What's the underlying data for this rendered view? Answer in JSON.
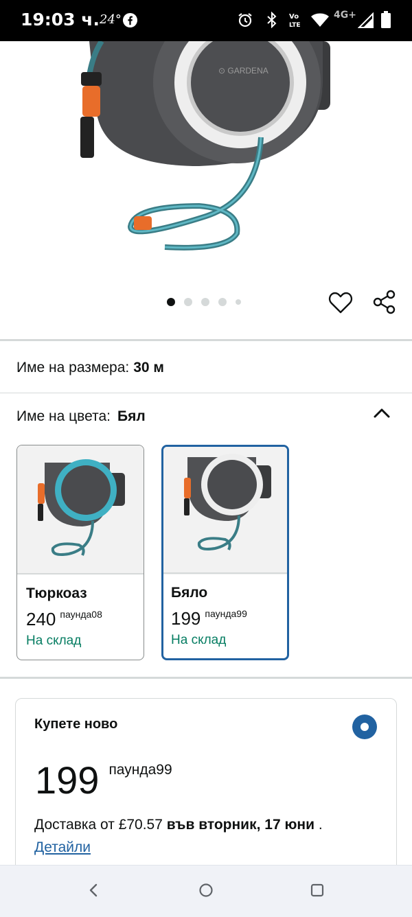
{
  "status_bar": {
    "time": "19:03 ч.",
    "temperature": "24°",
    "network": "4G+",
    "icons": [
      "facebook-icon",
      "alarm-icon",
      "bluetooth-icon",
      "volte-icon",
      "wifi-icon",
      "signal-icon",
      "battery-icon"
    ]
  },
  "product_image": {
    "brand_logo": "GARDENA",
    "carousel_count": 5,
    "carousel_active_index": 0
  },
  "size": {
    "label": "Име на размера:",
    "value": "30 м"
  },
  "color": {
    "label": "Име на цвета:",
    "value": "Бял",
    "options": [
      {
        "name": "Тюркоаз",
        "price_whole": "240",
        "price_fraction": "паунда08",
        "stock": "На склад",
        "selected": false,
        "accent": "#3aa6b9"
      },
      {
        "name": "Бяло",
        "price_whole": "199",
        "price_fraction": "паунда99",
        "stock": "На склад",
        "selected": true,
        "accent": "#e8e8e8"
      }
    ]
  },
  "buy_box": {
    "title": "Купете ново",
    "price_whole": "199",
    "price_fraction": "паунда99",
    "delivery_prefix": "Доставка от £70.57",
    "delivery_date": "във вторник, 17 юни",
    "delivery_suffix": " .",
    "details_link": "Детайли"
  },
  "colors": {
    "accent_blue": "#2162a1",
    "in_stock_green": "#067d62",
    "divider": "#d5d9d9"
  }
}
